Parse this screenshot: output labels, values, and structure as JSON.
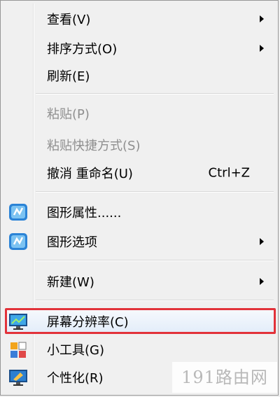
{
  "menu": {
    "items": {
      "view": {
        "label": "查看(V)"
      },
      "sort": {
        "label": "排序方式(O)"
      },
      "refresh": {
        "label": "刷新(E)"
      },
      "paste": {
        "label": "粘贴(P)"
      },
      "paste_shortcut": {
        "label": "粘贴快捷方式(S)"
      },
      "undo_rename": {
        "label": "撤消 重命名(U)",
        "shortcut": "Ctrl+Z"
      },
      "graphics_properties": {
        "label": "图形属性......"
      },
      "graphics_options": {
        "label": "图形选项"
      },
      "new": {
        "label": "新建(W)"
      },
      "screen_resolution": {
        "label": "屏幕分辨率(C)"
      },
      "gadgets": {
        "label": "小工具(G)"
      },
      "personalize": {
        "label": "个性化(R)"
      }
    },
    "icons": {
      "graphics_properties": "intel-graphics-icon",
      "graphics_options": "intel-graphics-icon",
      "screen_resolution": "monitor-icon",
      "gadgets": "gadgets-icon",
      "personalize": "personalize-monitor-icon"
    },
    "highlight_color": "#e2323a"
  },
  "watermark": {
    "text": "191路由网"
  }
}
